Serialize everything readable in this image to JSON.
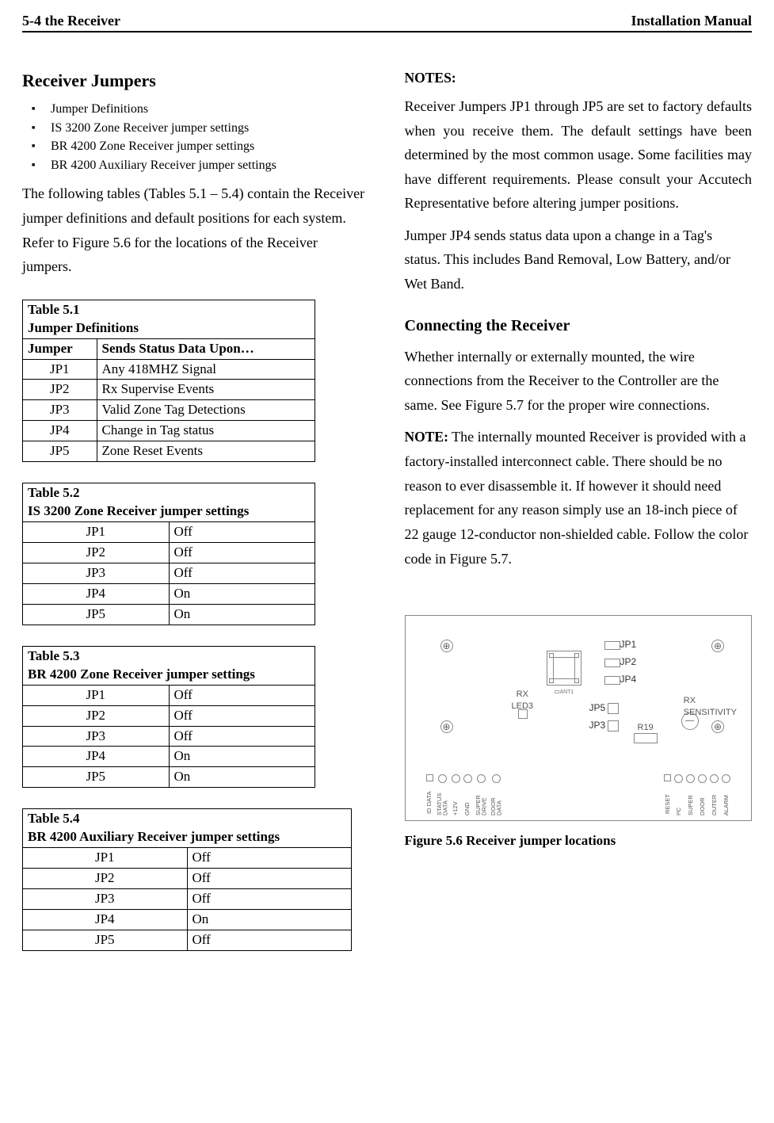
{
  "header": {
    "left": "5-4 the Receiver",
    "right": "Installation Manual"
  },
  "left": {
    "section_title": "Receiver Jumpers",
    "bullets": [
      "Jumper Definitions",
      "IS 3200 Zone Receiver jumper settings",
      "BR 4200 Zone Receiver jumper settings",
      "BR 4200 Auxiliary Receiver jumper settings"
    ],
    "intro": "The following tables (Tables 5.1 – 5.4) contain the Receiver jumper definitions and default positions for each system. Refer to Figure 5.6 for the locations of the Receiver jumpers.",
    "table51": {
      "title1": "Table 5.1",
      "title2": "Jumper Definitions",
      "h1": "Jumper",
      "h2": "Sends Status Data Upon…",
      "rows": [
        {
          "a": "JP1",
          "b": "Any 418MHZ Signal"
        },
        {
          "a": "JP2",
          "b": "Rx Supervise Events"
        },
        {
          "a": "JP3",
          "b": "Valid Zone Tag Detections"
        },
        {
          "a": "JP4",
          "b": "Change in Tag status"
        },
        {
          "a": "JP5",
          "b": "Zone Reset Events"
        }
      ]
    },
    "table52": {
      "title1": "Table 5.2",
      "title2": "IS 3200 Zone Receiver jumper settings",
      "rows": [
        {
          "a": "JP1",
          "b": "Off"
        },
        {
          "a": "JP2",
          "b": "Off"
        },
        {
          "a": "JP3",
          "b": "Off"
        },
        {
          "a": "JP4",
          "b": "On"
        },
        {
          "a": "JP5",
          "b": "On"
        }
      ]
    },
    "table53": {
      "title1": "Table 5.3",
      "title2": "BR 4200 Zone Receiver jumper settings",
      "rows": [
        {
          "a": "JP1",
          "b": "Off"
        },
        {
          "a": "JP2",
          "b": "Off"
        },
        {
          "a": "JP3",
          "b": "Off"
        },
        {
          "a": "JP4",
          "b": "On"
        },
        {
          "a": "JP5",
          "b": "On"
        }
      ]
    },
    "table54": {
      "title1": "Table 5.4",
      "title2": "BR 4200 Auxiliary Receiver jumper settings",
      "rows": [
        {
          "a": "JP1",
          "b": "Off"
        },
        {
          "a": "JP2",
          "b": "Off"
        },
        {
          "a": "JP3",
          "b": "Off"
        },
        {
          "a": "JP4",
          "b": "On"
        },
        {
          "a": "JP5",
          "b": "Off"
        }
      ]
    }
  },
  "right": {
    "notes_label": "NOTES:",
    "para1": "Receiver Jumpers JP1 through JP5 are set to factory defaults when you receive them. The default settings have been determined by the most common usage. Some facilities may have different requirements. Please consult your Accutech Representative before altering jumper positions.",
    "para2": "Jumper JP4 sends status data upon a change in a Tag's status. This includes Band Removal, Low Battery, and/or Wet Band.",
    "conn_title": "Connecting the Receiver",
    "para3": "Whether internally or externally mounted, the wire connections from the Receiver to the Controller are the same. See Figure 5.7 for the proper wire connections.",
    "note_label": "NOTE:",
    "note_body": " The internally mounted Receiver is provided with a factory-installed interconnect cable. There should be no reason to ever disassemble it. If however it should need replacement for any reason simply use an 18-inch piece of 22 gauge 12-conductor non-shielded cable. Follow the color code in Figure 5.7.",
    "figure": {
      "jp1": "JP1",
      "jp2": "JP2",
      "jp4": "JP4",
      "jp5": "JP5",
      "jp3": "JP3",
      "rx_led": "RX\nLED3",
      "rx_sens": "RX\nSENSITIVITY",
      "r19": "R19",
      "ant": "ANT1",
      "pins_left": [
        "ID DATA",
        "STATUS DATA",
        "+12V",
        "GND",
        "SUPER DRIVE",
        "DOOR DATA"
      ],
      "pins_right": [
        "RESET",
        "I²C",
        "SUPER",
        "DOOR",
        "OUTER",
        "ALARM"
      ]
    },
    "caption": "Figure 5.6 Receiver jumper locations"
  }
}
